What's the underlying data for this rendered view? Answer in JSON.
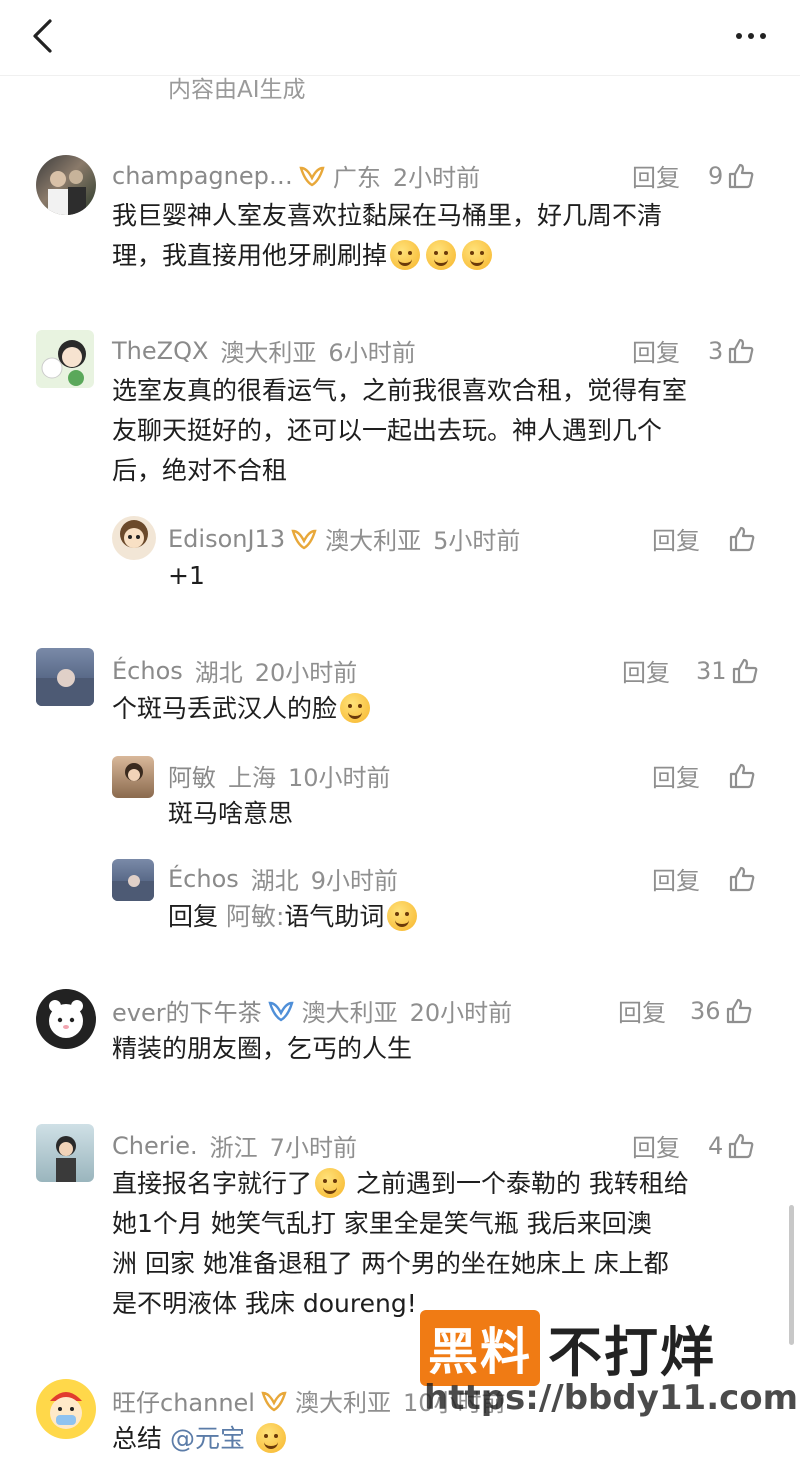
{
  "ai_note": "内容由AI生成",
  "reply_label": "回复",
  "comments": [
    {
      "user": "champagnep…",
      "location": "广东",
      "time": "2小时前",
      "likes": "9",
      "text_a": "我巨婴神人室友喜欢拉黏屎在马桶里，好几周不清",
      "text_b": "理，我直接用他牙刷刷掉"
    },
    {
      "user": "TheZQX",
      "location": "澳大利亚",
      "time": "6小时前",
      "likes": "3",
      "text_a": "选室友真的很看运气，之前我很喜欢合租，觉得有室",
      "text_b": "友聊天挺好的，还可以一起出去玩。神人遇到几个",
      "text_c": "后，绝对不合租"
    },
    {
      "user": "EdisonJ13",
      "location": "澳大利亚",
      "time": "5小时前",
      "likes": "",
      "text_a": "+1"
    },
    {
      "user": "Échos",
      "location": "湖北",
      "time": "20小时前",
      "likes": "31",
      "text_a": "个斑马丢武汉人的脸"
    },
    {
      "user": "阿敏",
      "location": "上海",
      "time": "10小时前",
      "likes": "",
      "text_a": "斑马啥意思"
    },
    {
      "user": "Échos",
      "location": "湖北",
      "time": "9小时前",
      "likes": "",
      "reply_prefix": "回复",
      "reply_to": "阿敏:",
      "text_a": "语气助词"
    },
    {
      "user": "ever的下午茶",
      "location": "澳大利亚",
      "time": "20小时前",
      "likes": "36",
      "text_a": "精装的朋友圈，乞丐的人生"
    },
    {
      "user": "Cherie.",
      "location": "浙江",
      "time": "7小时前",
      "likes": "4",
      "text_a": "直接报名字就行了",
      "text_a2": "之前遇到一个泰勒的 我转租给",
      "text_b": "她1个月 她笑气乱打 家里全是笑气瓶 我后来回澳",
      "text_c": "洲 回家 她准备退租了 两个男的坐在她床上 床上都",
      "text_d": "是不明液体 我床 doureng!"
    },
    {
      "user": "旺仔channel",
      "location": "澳大利亚",
      "time": "10小时前",
      "likes": "",
      "text_a": "总结",
      "mention": "@元宝"
    }
  ],
  "watermark": {
    "box": "黑料",
    "text": "不打烊",
    "url": "https://bbdy11.com"
  },
  "colors": {
    "accent_orange": "#f07b14",
    "meta_gray": "#8f8f8f",
    "mention_blue": "#5b7ca8",
    "badge_gold": "#e8a83a",
    "badge_blue": "#4f8fd8"
  }
}
